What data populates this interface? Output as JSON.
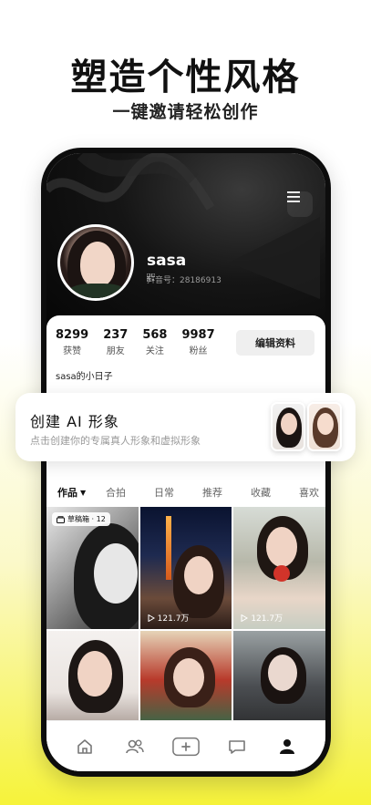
{
  "promo": {
    "headline": "塑造个性风格",
    "subline": "一键邀请轻松创作"
  },
  "profile": {
    "username": "sasa",
    "douyin_id_label": "抖音号：28186913",
    "stats": [
      {
        "num": "8299",
        "label": "获赞"
      },
      {
        "num": "237",
        "label": "朋友"
      },
      {
        "num": "568",
        "label": "关注"
      },
      {
        "num": "9987",
        "label": "粉丝"
      }
    ],
    "edit_button": "编辑资料",
    "bio": "sasa的小日子"
  },
  "ai_card": {
    "title": "创建 AI 形象",
    "subtitle": "点击创建你的专属真人形象和虚拟形象"
  },
  "tabs": [
    "作品",
    "合拍",
    "日常",
    "推荐",
    "收藏",
    "喜欢"
  ],
  "grid": {
    "draft_badge": "草稿箱 · 12",
    "play_count_1": "121.7万",
    "play_count_2": "121.7万"
  },
  "icons": {
    "menu": "hamburger-icon",
    "home": "home-icon",
    "friends": "friends-icon",
    "add": "plus-icon",
    "message": "message-icon",
    "me": "person-icon"
  },
  "colors": {
    "accent_yellow": "#f6f33a",
    "dark": "#0d0d0d"
  }
}
